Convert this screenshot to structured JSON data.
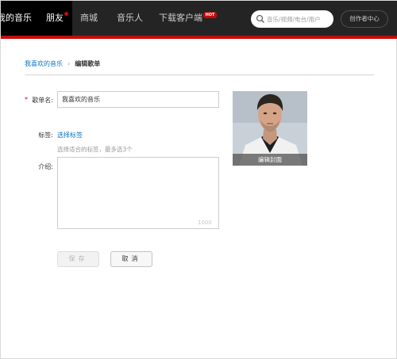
{
  "nav": {
    "items": [
      {
        "label": "我的音乐"
      },
      {
        "label": "朋友"
      },
      {
        "label": "商城"
      },
      {
        "label": "音乐人"
      },
      {
        "label": "下载客户端"
      }
    ],
    "hot_badge": "HOT",
    "search_placeholder": "音乐/视频/电台/用户",
    "creator_label": "创作者中心",
    "accent_color": "#c20c0c"
  },
  "breadcrumb": {
    "parent": "我喜欢的音乐",
    "current": "编辑歌单"
  },
  "form": {
    "required_mark": "*",
    "name_label": "歌单名:",
    "name_value": "我喜欢的音乐",
    "tags_label": "标签:",
    "tags_link": "选择标签",
    "tags_hint": "选择适合的标签，最多选3个",
    "desc_label": "介绍:",
    "desc_value": "",
    "desc_counter": "1000",
    "save_label": "保存",
    "cancel_label": "取消"
  },
  "cover": {
    "edit_label": "编辑封面"
  }
}
